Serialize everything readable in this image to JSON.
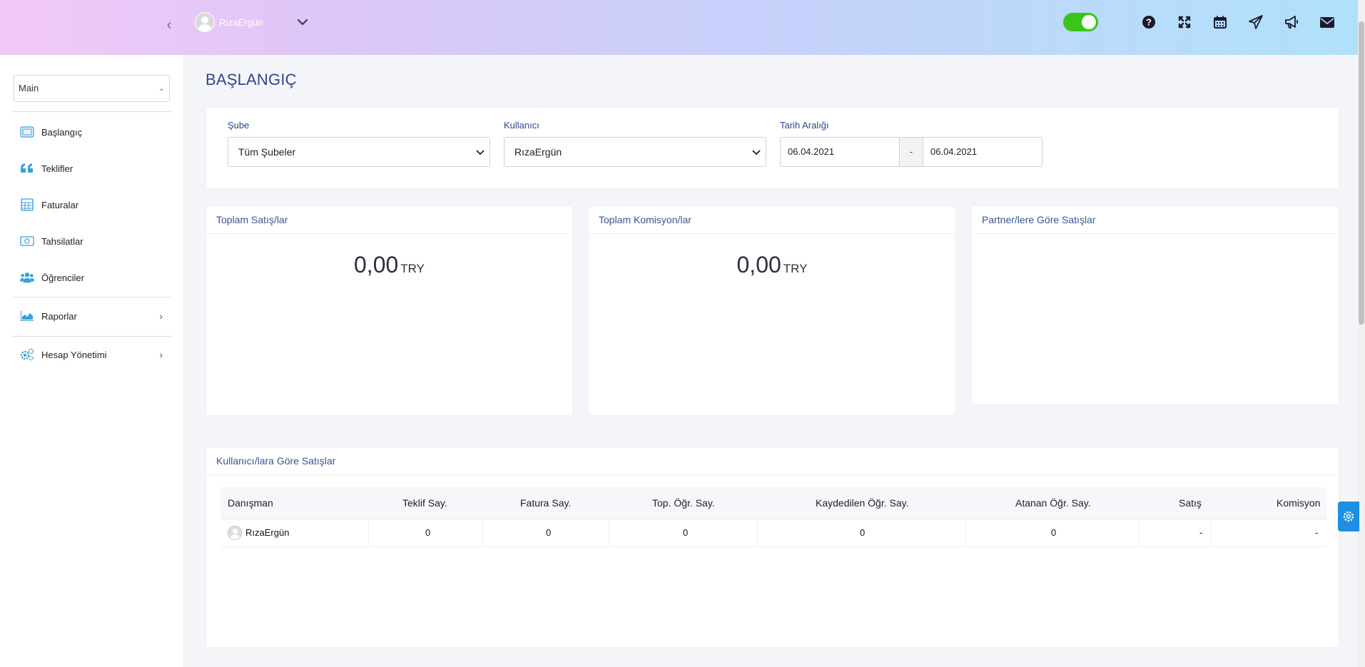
{
  "header": {
    "user_name": "RızaErgün",
    "toggle_on": true,
    "icons": [
      "help-icon",
      "fullscreen-icon",
      "calendar-icon",
      "send-icon",
      "megaphone-icon",
      "mail-icon"
    ]
  },
  "sidebar": {
    "workspace": "Main",
    "items": [
      {
        "label": "Başlangıç",
        "icon": "dashboard-icon"
      },
      {
        "label": "Teklifler",
        "icon": "quote-icon"
      },
      {
        "label": "Faturalar",
        "icon": "calculator-icon"
      },
      {
        "label": "Tahsilatlar",
        "icon": "money-icon"
      },
      {
        "label": "Öğrenciler",
        "icon": "users-icon"
      },
      {
        "label": "Raporlar",
        "icon": "chart-icon"
      },
      {
        "label": "Hesap Yönetimi",
        "icon": "cogs-icon"
      }
    ]
  },
  "page": {
    "title": "BAŞLANGIÇ"
  },
  "filters": {
    "branch_label": "Şube",
    "branch_value": "Tüm Şubeler",
    "user_label": "Kullanıcı",
    "user_value": "RızaErgün",
    "date_label": "Tarih Aralığı",
    "date_from": "06.04.2021",
    "date_sep": "-",
    "date_to": "06.04.2021"
  },
  "stats": {
    "sales": {
      "title": "Toplam Satış/lar",
      "value": "0,00",
      "currency": "TRY"
    },
    "commission": {
      "title": "Toplam Komisyon/lar",
      "value": "0,00",
      "currency": "TRY"
    },
    "partner": {
      "title": "Partner/lere Göre Satışlar"
    }
  },
  "user_sales": {
    "title": "Kullanıcı/lara Göre Satışlar",
    "columns": [
      "Danışman",
      "Teklif Say.",
      "Fatura Say.",
      "Top. Öğr. Say.",
      "Kaydedilen Öğr. Say.",
      "Atanan Öğr. Say.",
      "Satış",
      "Komisyon"
    ],
    "rows": [
      {
        "advisor": "RızaErgün",
        "offers": "0",
        "invoices": "0",
        "students": "0",
        "registered": "0",
        "assigned": "0",
        "sales": "-",
        "commission": "-"
      }
    ]
  },
  "colors": {
    "accent": "#30478a",
    "toggle": "#3cc41c",
    "settings_tab": "#1e8fe1",
    "icon_blue": "#3b9fd9"
  }
}
